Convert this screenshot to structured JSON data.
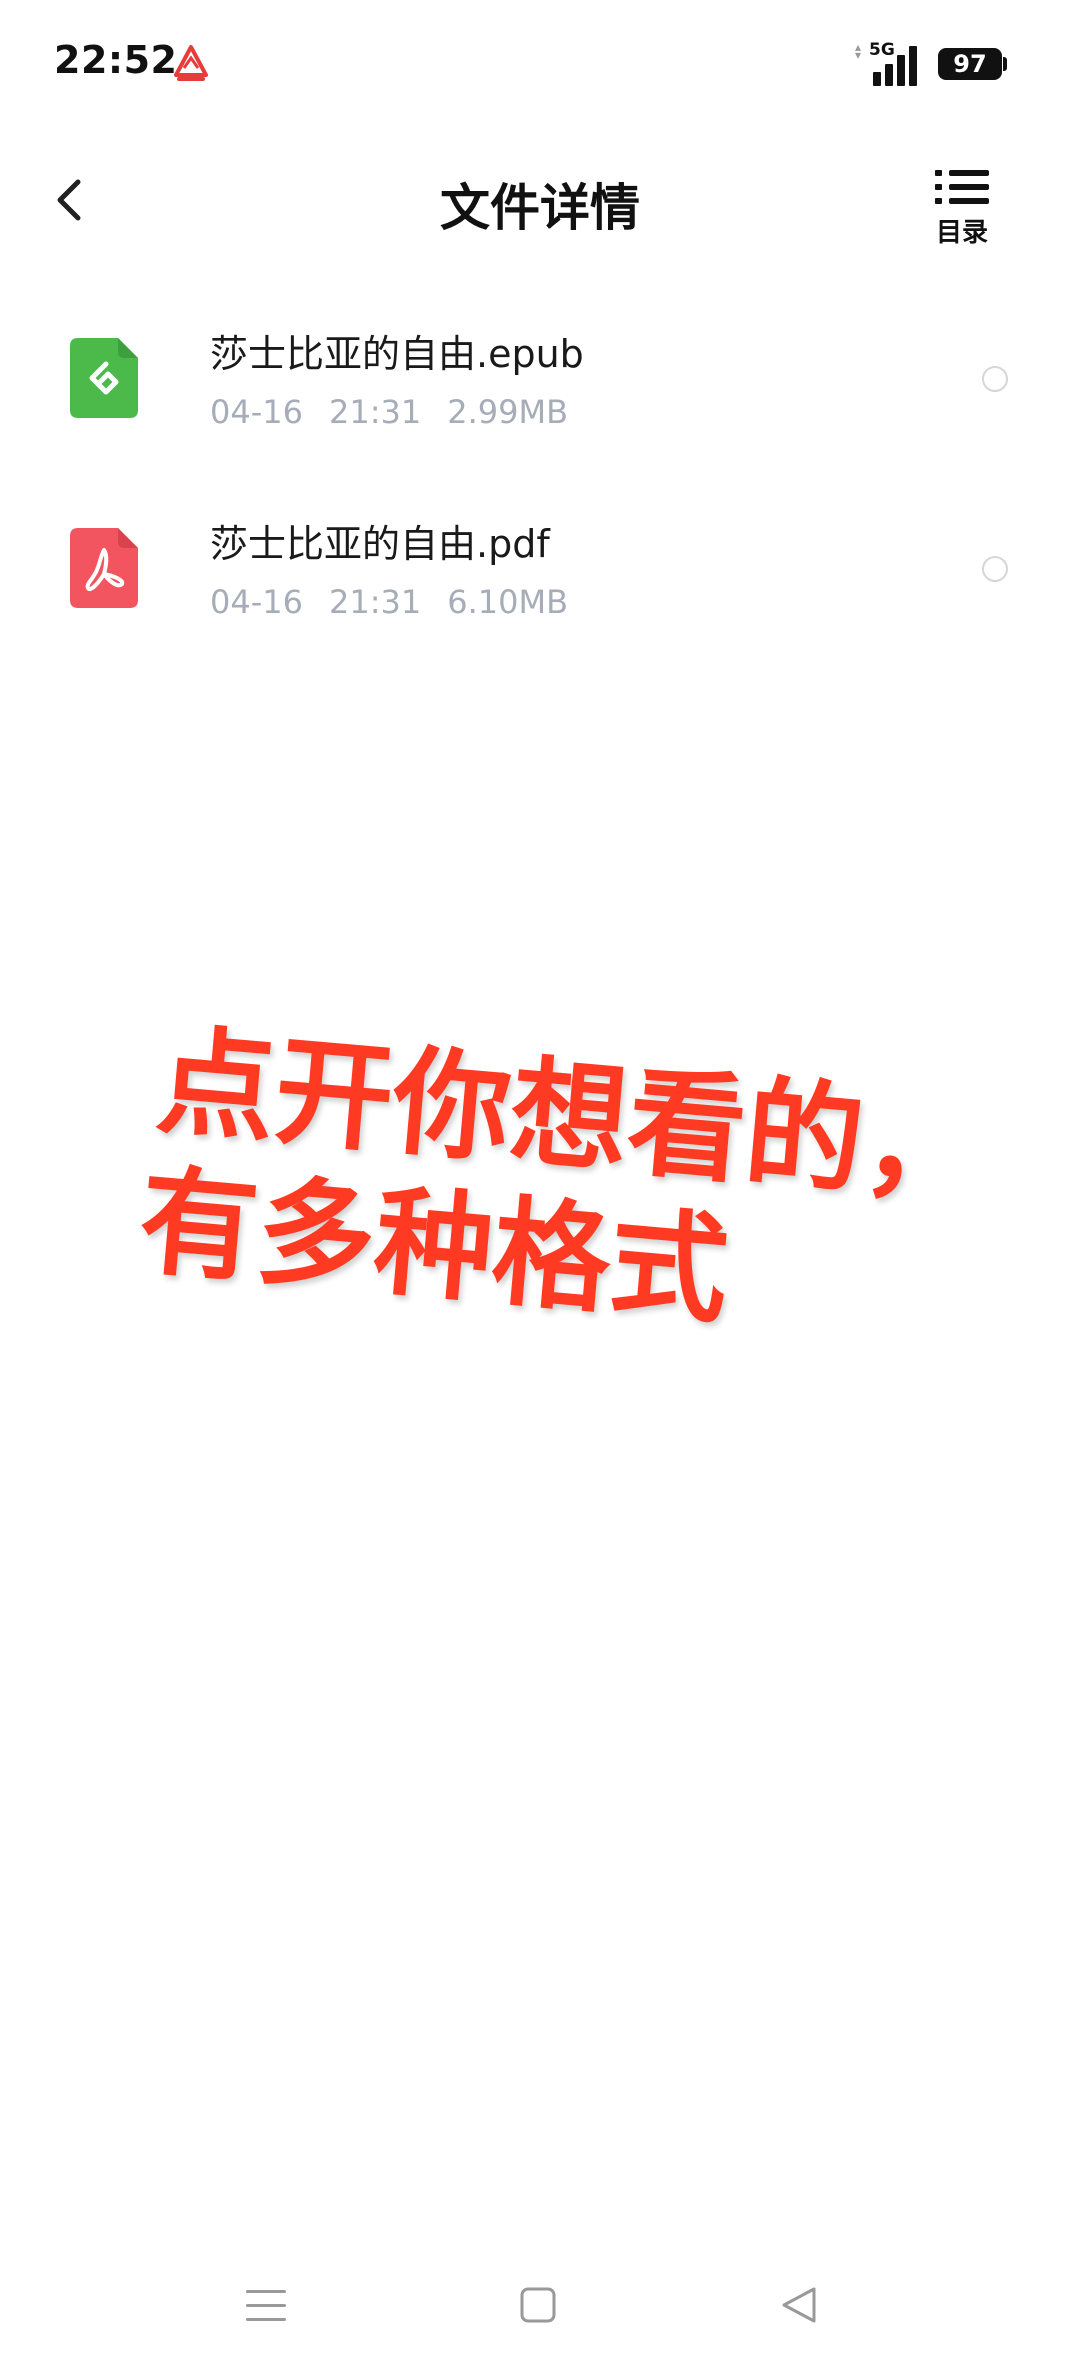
{
  "status_bar": {
    "time": "22:52",
    "network": "5G",
    "battery": "97"
  },
  "header": {
    "title": "文件详情",
    "toc_label": "目录"
  },
  "files": [
    {
      "name": "莎士比亚的自由.epub",
      "date": "04-16",
      "time": "21:31",
      "size": "2.99MB",
      "icon": "epub-file-icon",
      "color": "#4cba4a"
    },
    {
      "name": "莎士比亚的自由.pdf",
      "date": "04-16",
      "time": "21:31",
      "size": "6.10MB",
      "icon": "pdf-file-icon",
      "color": "#f2555f"
    }
  ],
  "overlay": {
    "line1": "点开你想看的，",
    "line2": "有多种格式",
    "color": "#ff3a22"
  }
}
